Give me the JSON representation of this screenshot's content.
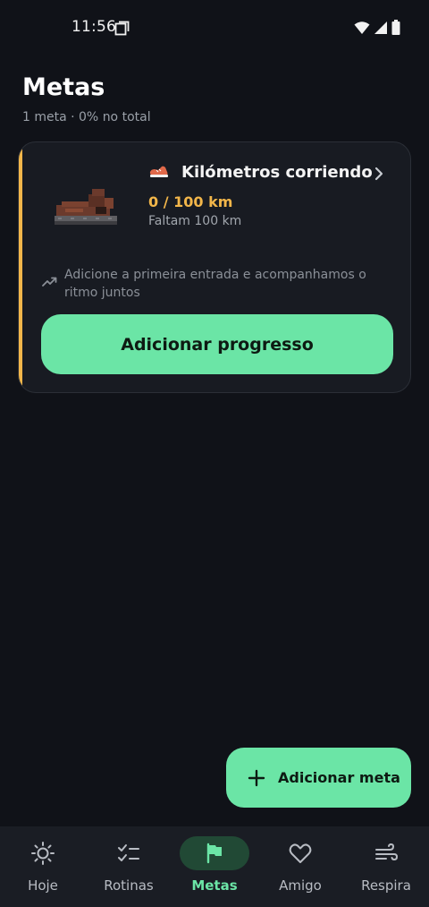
{
  "status_bar": {
    "time": "11:56",
    "icons": [
      "screen-record-icon",
      "wifi-icon",
      "signal-icon",
      "battery-icon"
    ]
  },
  "header": {
    "title": "Metas",
    "subtitle": "1 meta · 0% no total"
  },
  "goal_card": {
    "emoji": "running-shoe",
    "title": "Kilómetros corriendo",
    "progress": "0 / 100 km",
    "remaining": "Faltam 100 km",
    "hint": "Adicione a primeira entrada e acompanhamos o ritmo juntos",
    "button_label": "Adicionar progresso",
    "progress_value": 0,
    "accent_color": "#f2b64a"
  },
  "fab": {
    "label": "Adicionar meta",
    "icon": "plus-icon"
  },
  "bottom_nav": {
    "items": [
      {
        "label": "Hoje",
        "icon": "sun-icon",
        "active": false
      },
      {
        "label": "Rotinas",
        "icon": "checklist-icon",
        "active": false
      },
      {
        "label": "Metas",
        "icon": "flag-icon",
        "active": true
      },
      {
        "label": "Amigo",
        "icon": "heart-icon",
        "active": false
      },
      {
        "label": "Respira",
        "icon": "wind-icon",
        "active": false
      }
    ]
  },
  "colors": {
    "background": "#101218",
    "card": "#181b22",
    "primary": "#6be5a6",
    "accent": "#f2b64a",
    "nav_background": "#1a1d24"
  }
}
